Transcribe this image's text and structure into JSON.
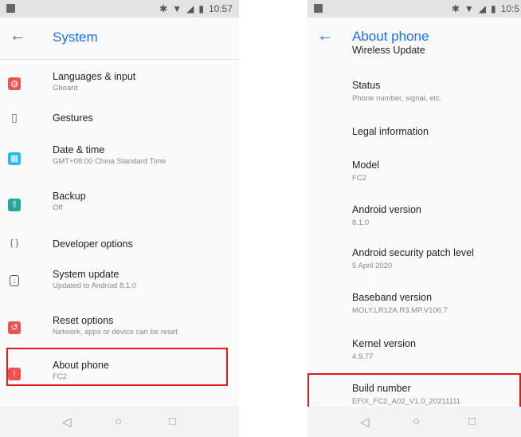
{
  "left": {
    "status_time": "10:57",
    "title": "System",
    "items": [
      {
        "label": "Languages & input",
        "sub": "Gboard",
        "icon": "globe-icon",
        "color": "#ef5350"
      },
      {
        "label": "Gestures",
        "sub": "",
        "icon": "gestures-icon",
        "color": "#9e9e9e"
      },
      {
        "label": "Date & time",
        "sub": "GMT+08:00 China Standard Time",
        "icon": "calendar-icon",
        "color": "#29b6f6"
      },
      {
        "label": "Backup",
        "sub": "Off",
        "icon": "backup-icon",
        "color": "#26a69a"
      },
      {
        "label": "Developer options",
        "sub": "",
        "icon": "braces-icon",
        "color": "#9e9e9e"
      },
      {
        "label": "System update",
        "sub": "Updated to Android 8.1.0",
        "icon": "system-update-icon",
        "color": "#757575"
      },
      {
        "label": "Reset options",
        "sub": "Network, apps or device can be reset",
        "icon": "reset-icon",
        "color": "#ef5350"
      },
      {
        "label": "About phone",
        "sub": "FC2",
        "icon": "info-icon",
        "color": "#ef5350"
      }
    ]
  },
  "right": {
    "status_time": "10:5",
    "title": "About phone",
    "items": [
      {
        "label": "Wireless Update",
        "sub": ""
      },
      {
        "label": "Status",
        "sub": "Phone number, signal, etc."
      },
      {
        "label": "Legal information",
        "sub": ""
      },
      {
        "label": "Model",
        "sub": "FC2"
      },
      {
        "label": "Android version",
        "sub": "8.1.0"
      },
      {
        "label": "Android security patch level",
        "sub": "5 April 2020"
      },
      {
        "label": "Baseband version",
        "sub": "MOLY.LR12A.R3.MP.V106.7"
      },
      {
        "label": "Kernel version",
        "sub": "4.9.77"
      },
      {
        "label": "Build number",
        "sub": "EFIX_FC2_A02_V1.0_20211111"
      }
    ]
  },
  "nav": {
    "back": "◁",
    "home": "○",
    "recents": "□"
  },
  "highlight_color": "#e01b1b"
}
